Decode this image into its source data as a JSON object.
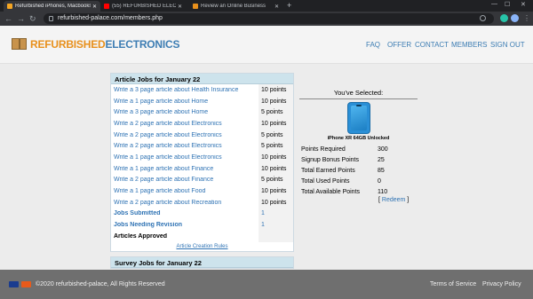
{
  "browser": {
    "tabs": [
      {
        "title": "Refurbished iPhones, Macbooks...",
        "color": "#f5a623"
      },
      {
        "title": "(55) REFURBISHED ELECTRONIC...",
        "color": "#ff0000"
      },
      {
        "title": "Review an Online Business",
        "color": "#e8901c"
      }
    ],
    "new_tab": "+",
    "url": "refurbished-palace.com/members.php",
    "win_min": "—",
    "win_max": "☐",
    "win_close": "✕"
  },
  "site": {
    "logo_part1": "REFURBISHED",
    "logo_part2": "ELECTRONICS",
    "nav": [
      "FAQ",
      "OFFER",
      "CONTACT",
      "MEMBERS",
      "SIGN OUT"
    ]
  },
  "jobs": {
    "title": "Article Jobs for January 22",
    "rows": [
      {
        "title": "Write a 3 page article about Health Insurance",
        "points": "10 points"
      },
      {
        "title": "Write a 1 page article about Home",
        "points": "10 points"
      },
      {
        "title": "Write a 3 page article about Home",
        "points": "5 points"
      },
      {
        "title": "Write a 2 page article about Electronics",
        "points": "10 points"
      },
      {
        "title": "Write a 2 page article about Electronics",
        "points": "5 points"
      },
      {
        "title": "Write a 2 page article about Electronics",
        "points": "5 points"
      },
      {
        "title": "Write a 1 page article about Electronics",
        "points": "10 points"
      },
      {
        "title": "Write a 1 page article about Finance",
        "points": "10 points"
      },
      {
        "title": "Write a 2 page article about Finance",
        "points": "5 points"
      },
      {
        "title": "Write a 1 page article about Food",
        "points": "10 points"
      },
      {
        "title": "Write a 2 page article about Recreation",
        "points": "10 points"
      }
    ],
    "submitted_label": "Jobs Submitted",
    "submitted_value": "1",
    "revision_label": "Jobs Needing Revision",
    "revision_value": "1",
    "approved_label": "Articles Approved",
    "approved_value": "",
    "rules_link": "Article Creation Rules"
  },
  "survey": {
    "title": "Survey Jobs for January 22"
  },
  "selected": {
    "heading": "You've Selected:",
    "product_name": "iPhone XR 64GB Unlocked",
    "stats": [
      {
        "label": "Points Required",
        "value": "300"
      },
      {
        "label": "Signup Bonus Points",
        "value": "25"
      },
      {
        "label": "Total Earned Points",
        "value": "85"
      },
      {
        "label": "Total Used Points",
        "value": "0"
      },
      {
        "label": "Total Available Points",
        "value": "110"
      }
    ],
    "redeem_open": "[ ",
    "redeem_label": "Redeem",
    "redeem_close": " ]"
  },
  "footer": {
    "copyright": "©2020 refurbished-palace, All Rights Reserved",
    "terms": "Terms of Service",
    "privacy": "Privacy Policy"
  }
}
